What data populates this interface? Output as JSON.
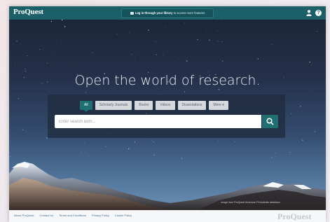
{
  "header": {
    "logo": "ProQuest",
    "login_prefix": "Log in through your library",
    "login_suffix": " to access more features",
    "user_icon": "user-icon",
    "help_icon": "help-icon",
    "help_glyph": "?"
  },
  "hero": {
    "headline": "Open the world of research.",
    "credit": "Image from ProQuest American Periodicals database"
  },
  "search": {
    "tabs": [
      {
        "label": "All",
        "active": true
      },
      {
        "label": "Scholarly Journals",
        "active": false
      },
      {
        "label": "Books",
        "active": false
      },
      {
        "label": "Videos",
        "active": false
      },
      {
        "label": "Dissertations",
        "active": false
      },
      {
        "label": "More ▾",
        "active": false
      }
    ],
    "placeholder": "Enter search term...",
    "button_icon": "search-icon"
  },
  "footer": {
    "links": [
      "About ProQuest",
      "Contact Us",
      "Terms and Conditions",
      "Privacy Policy",
      "Cookie Policy"
    ],
    "logo": "ProQuest"
  },
  "colors": {
    "topbar": "#1b5f69",
    "accent": "#1f6f73",
    "footer_link": "#3b6a92"
  }
}
